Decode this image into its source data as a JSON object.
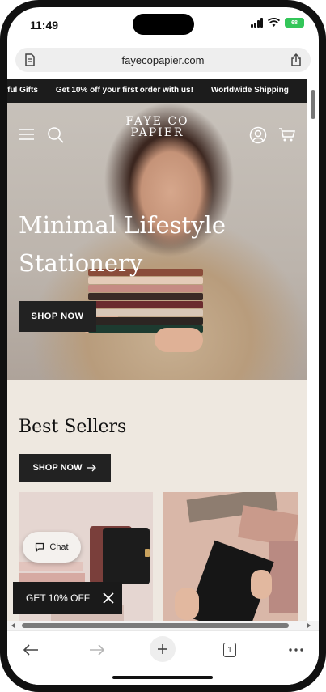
{
  "status_bar": {
    "time": "11:49",
    "battery": "68"
  },
  "browser": {
    "url": "fayecopapier.com",
    "tab_count": "1"
  },
  "announcement": {
    "items": [
      "dful Gifts",
      "Get 10% off your first order with us!",
      "Worldwide Shipping"
    ]
  },
  "header": {
    "logo_line1": "FAYE CO",
    "logo_line2": "PAPIER"
  },
  "hero": {
    "title_line1": "Minimal Lifestyle",
    "title_line2": "Stationery",
    "button": "SHOP NOW"
  },
  "best_sellers": {
    "title": "Best Sellers",
    "button": "SHOP NOW"
  },
  "chat": {
    "label": "Chat"
  },
  "promo": {
    "label": "GET 10% OFF"
  },
  "colors": {
    "dark": "#1c1c1c",
    "section_bg": "#eee8e0",
    "battery": "#33c659"
  }
}
